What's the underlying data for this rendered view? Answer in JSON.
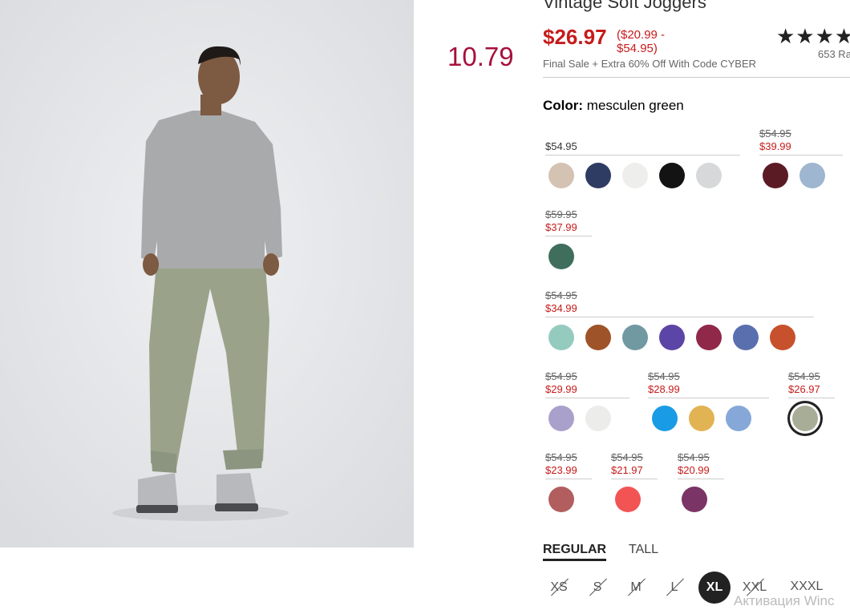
{
  "product": {
    "title": "Vintage Soft Joggers",
    "sale_price": "$26.97",
    "price_range_line1": "($20.99 -",
    "price_range_line2": "$54.95)",
    "promo": "Final Sale + Extra 60% Off With Code CYBER",
    "stars": "★★★★",
    "ratings_text": "653 Ra"
  },
  "overlay_price": "10.79",
  "color": {
    "label": "Color:",
    "selected_name": "mesculen green"
  },
  "price_groups": [
    {
      "regular": "$54.95",
      "swatches": [
        "#d4c2b2",
        "#2e3b63",
        "#eeeeec",
        "#131313",
        "#d7d8da"
      ]
    },
    {
      "was": "$54.95",
      "now": "$39.99",
      "swatches": [
        "#5b1b24",
        "#9eb6cf"
      ]
    },
    {
      "was": "$59.95",
      "now": "$37.99",
      "swatches": [
        "#3f6e5c"
      ]
    },
    {
      "was": "$54.95",
      "now": "$34.99",
      "swatches": [
        "#95cbbf",
        "#9f5328",
        "#7199a2",
        "#5b45a6",
        "#90284a",
        "#5a6fae",
        "#c7512c"
      ]
    },
    {
      "was": "$54.95",
      "now": "$29.99",
      "swatches": [
        "#a9a0cb",
        "#ececea"
      ]
    },
    {
      "was": "$54.95",
      "now": "$28.99",
      "swatches": [
        "#1a9be6",
        "#e2b352",
        "#85a8d8"
      ]
    },
    {
      "was": "$54.95",
      "now": "$26.97",
      "swatches": [
        "#a8ad98"
      ]
    },
    {
      "was": "$54.95",
      "now": "$23.99",
      "swatches": [
        "#b25e5e"
      ]
    },
    {
      "was": "$54.95",
      "now": "$21.97",
      "swatches": [
        "#f25454"
      ]
    },
    {
      "was": "$54.95",
      "now": "$20.99",
      "swatches": [
        "#7b3466"
      ]
    }
  ],
  "fit_tabs": [
    "REGULAR",
    "TALL"
  ],
  "sizes": [
    {
      "label": "XS",
      "available": false
    },
    {
      "label": "S",
      "available": false
    },
    {
      "label": "M",
      "available": false
    },
    {
      "label": "L",
      "available": false
    },
    {
      "label": "XL",
      "available": true,
      "selected": true
    },
    {
      "label": "XXL",
      "available": false
    },
    {
      "label": "XXXL",
      "available": true
    }
  ],
  "watermark": "Активация Winc"
}
